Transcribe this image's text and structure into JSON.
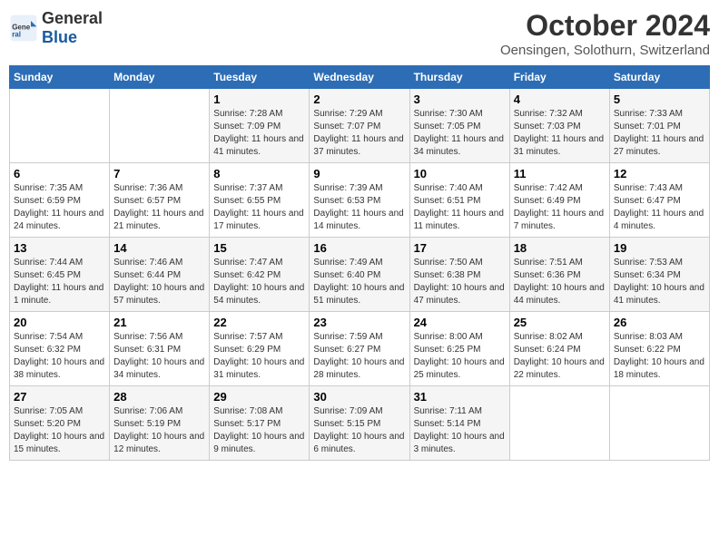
{
  "logo": {
    "general": "General",
    "blue": "Blue"
  },
  "header": {
    "month": "October 2024",
    "location": "Oensingen, Solothurn, Switzerland"
  },
  "weekdays": [
    "Sunday",
    "Monday",
    "Tuesday",
    "Wednesday",
    "Thursday",
    "Friday",
    "Saturday"
  ],
  "weeks": [
    [
      {
        "day": "",
        "info": ""
      },
      {
        "day": "",
        "info": ""
      },
      {
        "day": "1",
        "info": "Sunrise: 7:28 AM\nSunset: 7:09 PM\nDaylight: 11 hours and 41 minutes."
      },
      {
        "day": "2",
        "info": "Sunrise: 7:29 AM\nSunset: 7:07 PM\nDaylight: 11 hours and 37 minutes."
      },
      {
        "day": "3",
        "info": "Sunrise: 7:30 AM\nSunset: 7:05 PM\nDaylight: 11 hours and 34 minutes."
      },
      {
        "day": "4",
        "info": "Sunrise: 7:32 AM\nSunset: 7:03 PM\nDaylight: 11 hours and 31 minutes."
      },
      {
        "day": "5",
        "info": "Sunrise: 7:33 AM\nSunset: 7:01 PM\nDaylight: 11 hours and 27 minutes."
      }
    ],
    [
      {
        "day": "6",
        "info": "Sunrise: 7:35 AM\nSunset: 6:59 PM\nDaylight: 11 hours and 24 minutes."
      },
      {
        "day": "7",
        "info": "Sunrise: 7:36 AM\nSunset: 6:57 PM\nDaylight: 11 hours and 21 minutes."
      },
      {
        "day": "8",
        "info": "Sunrise: 7:37 AM\nSunset: 6:55 PM\nDaylight: 11 hours and 17 minutes."
      },
      {
        "day": "9",
        "info": "Sunrise: 7:39 AM\nSunset: 6:53 PM\nDaylight: 11 hours and 14 minutes."
      },
      {
        "day": "10",
        "info": "Sunrise: 7:40 AM\nSunset: 6:51 PM\nDaylight: 11 hours and 11 minutes."
      },
      {
        "day": "11",
        "info": "Sunrise: 7:42 AM\nSunset: 6:49 PM\nDaylight: 11 hours and 7 minutes."
      },
      {
        "day": "12",
        "info": "Sunrise: 7:43 AM\nSunset: 6:47 PM\nDaylight: 11 hours and 4 minutes."
      }
    ],
    [
      {
        "day": "13",
        "info": "Sunrise: 7:44 AM\nSunset: 6:45 PM\nDaylight: 11 hours and 1 minute."
      },
      {
        "day": "14",
        "info": "Sunrise: 7:46 AM\nSunset: 6:44 PM\nDaylight: 10 hours and 57 minutes."
      },
      {
        "day": "15",
        "info": "Sunrise: 7:47 AM\nSunset: 6:42 PM\nDaylight: 10 hours and 54 minutes."
      },
      {
        "day": "16",
        "info": "Sunrise: 7:49 AM\nSunset: 6:40 PM\nDaylight: 10 hours and 51 minutes."
      },
      {
        "day": "17",
        "info": "Sunrise: 7:50 AM\nSunset: 6:38 PM\nDaylight: 10 hours and 47 minutes."
      },
      {
        "day": "18",
        "info": "Sunrise: 7:51 AM\nSunset: 6:36 PM\nDaylight: 10 hours and 44 minutes."
      },
      {
        "day": "19",
        "info": "Sunrise: 7:53 AM\nSunset: 6:34 PM\nDaylight: 10 hours and 41 minutes."
      }
    ],
    [
      {
        "day": "20",
        "info": "Sunrise: 7:54 AM\nSunset: 6:32 PM\nDaylight: 10 hours and 38 minutes."
      },
      {
        "day": "21",
        "info": "Sunrise: 7:56 AM\nSunset: 6:31 PM\nDaylight: 10 hours and 34 minutes."
      },
      {
        "day": "22",
        "info": "Sunrise: 7:57 AM\nSunset: 6:29 PM\nDaylight: 10 hours and 31 minutes."
      },
      {
        "day": "23",
        "info": "Sunrise: 7:59 AM\nSunset: 6:27 PM\nDaylight: 10 hours and 28 minutes."
      },
      {
        "day": "24",
        "info": "Sunrise: 8:00 AM\nSunset: 6:25 PM\nDaylight: 10 hours and 25 minutes."
      },
      {
        "day": "25",
        "info": "Sunrise: 8:02 AM\nSunset: 6:24 PM\nDaylight: 10 hours and 22 minutes."
      },
      {
        "day": "26",
        "info": "Sunrise: 8:03 AM\nSunset: 6:22 PM\nDaylight: 10 hours and 18 minutes."
      }
    ],
    [
      {
        "day": "27",
        "info": "Sunrise: 7:05 AM\nSunset: 5:20 PM\nDaylight: 10 hours and 15 minutes."
      },
      {
        "day": "28",
        "info": "Sunrise: 7:06 AM\nSunset: 5:19 PM\nDaylight: 10 hours and 12 minutes."
      },
      {
        "day": "29",
        "info": "Sunrise: 7:08 AM\nSunset: 5:17 PM\nDaylight: 10 hours and 9 minutes."
      },
      {
        "day": "30",
        "info": "Sunrise: 7:09 AM\nSunset: 5:15 PM\nDaylight: 10 hours and 6 minutes."
      },
      {
        "day": "31",
        "info": "Sunrise: 7:11 AM\nSunset: 5:14 PM\nDaylight: 10 hours and 3 minutes."
      },
      {
        "day": "",
        "info": ""
      },
      {
        "day": "",
        "info": ""
      }
    ]
  ]
}
